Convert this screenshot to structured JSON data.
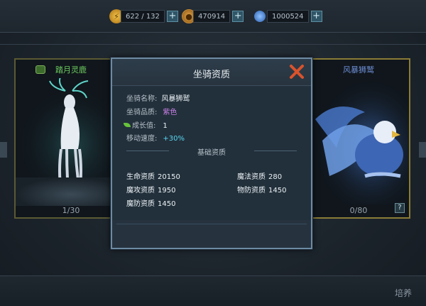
{
  "resources": {
    "energy": {
      "icon": "energy-icon",
      "value": "622 / 132"
    },
    "gold": {
      "icon": "coin-icon",
      "value": "470914"
    },
    "gems": {
      "icon": "gem-icon",
      "value": "1000524"
    },
    "plus_label": "+"
  },
  "left_card": {
    "name": "踏月灵鹿",
    "count": "1/30"
  },
  "right_card": {
    "name": "风暴狮鹫",
    "count": "0/80",
    "help_label": "?"
  },
  "dialog": {
    "title": "坐骑资质",
    "mount_name_label": "坐骑名称:",
    "mount_name": "风暴狮鹫",
    "quality_label": "坐骑品质:",
    "quality": "紫色",
    "growth_label": "成长值:",
    "growth": "1",
    "speed_label": "移动速度:",
    "speed": "+30%",
    "base_section": "基础资质",
    "stats": {
      "hp_label": "生命资质",
      "hp": "20150",
      "magic_label": "魔法资质",
      "magic": "280",
      "matk_label": "魔攻资质",
      "matk": "1950",
      "pdef_label": "物防资质",
      "pdef": "1450",
      "mdef_label": "魔防资质",
      "mdef": "1450"
    }
  },
  "bottom": {
    "foster_label": "培养"
  },
  "colors": {
    "quality_purple": "#c77ee6",
    "speed_cyan": "#58d6f0",
    "close_red": "#d9532c"
  }
}
